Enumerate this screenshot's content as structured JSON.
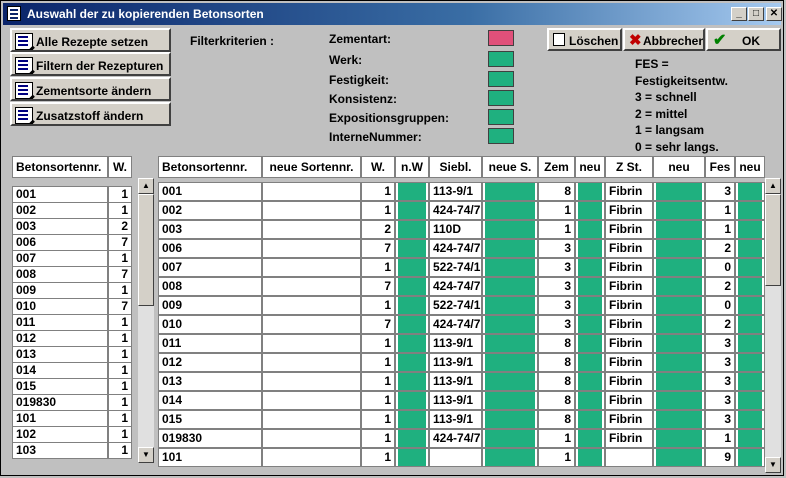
{
  "window": {
    "title": "Auswahl der zu kopierenden Betonsorten"
  },
  "actions": [
    {
      "label": "Alle Rezepte setzen"
    },
    {
      "label": "Filtern der Rezepturen"
    },
    {
      "label": "Zementsorte ändern"
    },
    {
      "label": "Zusatzstoff ändern"
    }
  ],
  "filter": {
    "title": "Filterkriterien :",
    "criteria": [
      {
        "label": "Zementart:",
        "color": "#e0507a"
      },
      {
        "label": "Werk:",
        "color": "#1fb07f"
      },
      {
        "label": "Festigkeit:",
        "color": "#1fb07f"
      },
      {
        "label": "Konsistenz:",
        "color": "#1fb07f"
      },
      {
        "label": "Expositionsgruppen:",
        "color": "#1fb07f"
      },
      {
        "label": "InterneNummer:",
        "color": "#1fb07f"
      }
    ]
  },
  "toolbar": {
    "delete_label": "Löschen",
    "cancel_label": "Abbrechen",
    "ok_label": "OK"
  },
  "legend": [
    "FES =",
    "Festigkeitsentw.",
    "3 = schnell",
    "2 = mittel",
    "1 = langsam",
    "0 = sehr langs."
  ],
  "left_table": {
    "headers": [
      "Betonsortennr.",
      "W."
    ],
    "rows": [
      [
        "001",
        "1"
      ],
      [
        "002",
        "1"
      ],
      [
        "003",
        "2"
      ],
      [
        "006",
        "7"
      ],
      [
        "007",
        "1"
      ],
      [
        "008",
        "7"
      ],
      [
        "009",
        "1"
      ],
      [
        "010",
        "7"
      ],
      [
        "011",
        "1"
      ],
      [
        "012",
        "1"
      ],
      [
        "013",
        "1"
      ],
      [
        "014",
        "1"
      ],
      [
        "015",
        "1"
      ],
      [
        "019830",
        "1"
      ],
      [
        "101",
        "1"
      ],
      [
        "102",
        "1"
      ],
      [
        "103",
        "1"
      ]
    ]
  },
  "main_table": {
    "headers": [
      "Betonsortennr.",
      "neue Sortennr.",
      "W.",
      "n.W",
      "Siebl.",
      "neue S.",
      "Zem",
      "neu",
      "Z St.",
      "neu",
      "Fes",
      "neu"
    ],
    "rows": [
      {
        "nr": "001",
        "neu_nr": "",
        "w": "1",
        "siebl": "113-9/1",
        "zem": "8",
        "zst": "Fibrin",
        "fes": "3"
      },
      {
        "nr": "002",
        "neu_nr": "",
        "w": "1",
        "siebl": "424-74/7",
        "zem": "1",
        "zst": "Fibrin",
        "fes": "1"
      },
      {
        "nr": "003",
        "neu_nr": "",
        "w": "2",
        "siebl": "110D",
        "zem": "1",
        "zst": "Fibrin",
        "fes": "1"
      },
      {
        "nr": "006",
        "neu_nr": "",
        "w": "7",
        "siebl": "424-74/7",
        "zem": "3",
        "zst": "Fibrin",
        "fes": "2"
      },
      {
        "nr": "007",
        "neu_nr": "",
        "w": "1",
        "siebl": "522-74/1",
        "zem": "3",
        "zst": "Fibrin",
        "fes": "0"
      },
      {
        "nr": "008",
        "neu_nr": "",
        "w": "7",
        "siebl": "424-74/7",
        "zem": "3",
        "zst": "Fibrin",
        "fes": "2"
      },
      {
        "nr": "009",
        "neu_nr": "",
        "w": "1",
        "siebl": "522-74/1",
        "zem": "3",
        "zst": "Fibrin",
        "fes": "0"
      },
      {
        "nr": "010",
        "neu_nr": "",
        "w": "7",
        "siebl": "424-74/7",
        "zem": "3",
        "zst": "Fibrin",
        "fes": "2"
      },
      {
        "nr": "011",
        "neu_nr": "",
        "w": "1",
        "siebl": "113-9/1",
        "zem": "8",
        "zst": "Fibrin",
        "fes": "3"
      },
      {
        "nr": "012",
        "neu_nr": "",
        "w": "1",
        "siebl": "113-9/1",
        "zem": "8",
        "zst": "Fibrin",
        "fes": "3"
      },
      {
        "nr": "013",
        "neu_nr": "",
        "w": "1",
        "siebl": "113-9/1",
        "zem": "8",
        "zst": "Fibrin",
        "fes": "3"
      },
      {
        "nr": "014",
        "neu_nr": "",
        "w": "1",
        "siebl": "113-9/1",
        "zem": "8",
        "zst": "Fibrin",
        "fes": "3"
      },
      {
        "nr": "015",
        "neu_nr": "",
        "w": "1",
        "siebl": "113-9/1",
        "zem": "8",
        "zst": "Fibrin",
        "fes": "3"
      },
      {
        "nr": "019830",
        "neu_nr": "",
        "w": "1",
        "siebl": "424-74/7",
        "zem": "1",
        "zst": "Fibrin",
        "fes": "1"
      },
      {
        "nr": "101",
        "neu_nr": "",
        "w": "1",
        "siebl": "",
        "zem": "1",
        "zst": "",
        "fes": "9"
      }
    ]
  },
  "colors": {
    "accent_green": "#1fb07f",
    "zementart_pink": "#e0507a",
    "title_bar": "#0a246a"
  }
}
